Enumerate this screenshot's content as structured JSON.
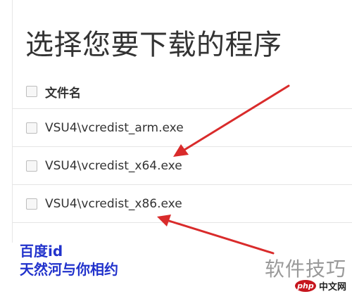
{
  "title": "选择您要下载的程序",
  "list": {
    "header_label": "文件名",
    "items": [
      {
        "label": "VSU4\\vcredist_arm.exe"
      },
      {
        "label": "VSU4\\vcredist_x64.exe"
      },
      {
        "label": "VSU4\\vcredist_x86.exe"
      }
    ]
  },
  "caption": {
    "line1": "百度id",
    "line2": "天然河与你相约"
  },
  "watermark": {
    "text": "软件技巧"
  },
  "php_logo": {
    "mark": "php",
    "site": "中文网"
  },
  "colors": {
    "arrow": "#d92b2b",
    "caption": "#2233cc",
    "row_divider": "#e5e5e5"
  }
}
